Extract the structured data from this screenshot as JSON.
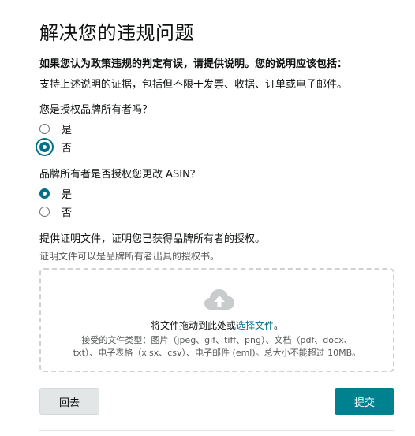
{
  "title": "解决您的违规问题",
  "instructions": {
    "bold": "如果您认为政策违规的判定有误，请提供说明。您的说明应该包括：",
    "normal": "支持上述说明的证据，包括但不限于发票、收据、订单或电子邮件。"
  },
  "question1": {
    "label": "您是授权品牌所有者吗？",
    "options": [
      "是",
      "否"
    ],
    "selected": "否"
  },
  "question2": {
    "label": "品牌所有者是否授权您更改 ASIN？",
    "options": [
      "是",
      "否"
    ],
    "selected": "是"
  },
  "proof": {
    "label": "提供证明文件，证明您已获得品牌所有者的授权。",
    "hint": "证明文件可以是品牌所有者出具的授权书。"
  },
  "upload": {
    "drop_prefix": "将文件拖动到此处或",
    "select_link": "选择文件",
    "drop_suffix": "。",
    "types_line1": "接受的文件类型：图片（jpeg、gif、tiff、png）、文档（pdf、docx、",
    "types_line2": "txt）、电子表格（xlsx、csv）、电子邮件 (eml)。总大小不能超过 10MB。",
    "icon": "cloud-upload-icon"
  },
  "buttons": {
    "back": "回去",
    "submit": "提交"
  },
  "colors": {
    "accent": "#007185",
    "submit_bg": "#00818f",
    "secondary_bg": "#e3e6e6"
  }
}
